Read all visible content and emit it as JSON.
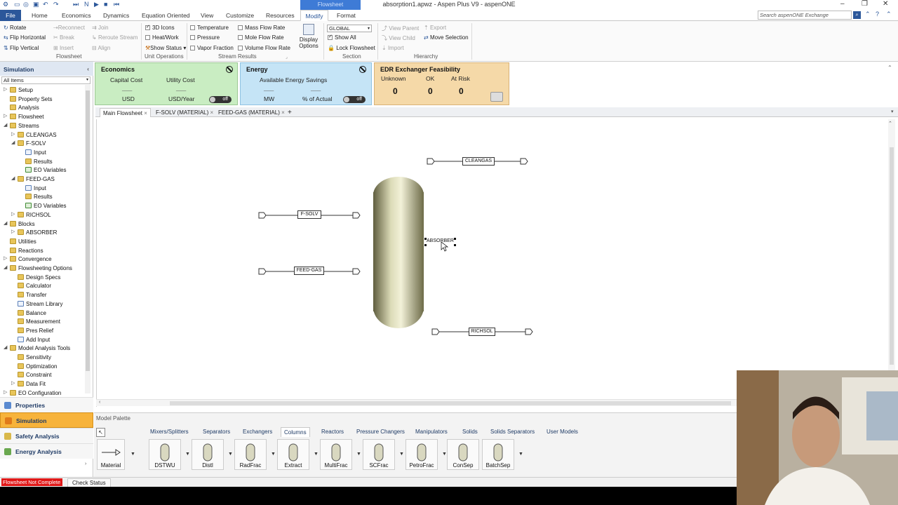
{
  "window": {
    "title": "absorption1.apwz - Aspen Plus V9 - aspenONE",
    "context_tab": "Flowsheet"
  },
  "menu": {
    "tabs": [
      "File",
      "Home",
      "Economics",
      "Dynamics",
      "Equation Oriented",
      "View",
      "Customize",
      "Resources",
      "Modify",
      "Format"
    ],
    "active": "Modify",
    "search_placeholder": "Search aspenONE Exchange"
  },
  "ribbon": {
    "flowsheet": {
      "rotate": "Rotate",
      "flip_horizontal": "Flip Horizontal",
      "flip_vertical": "Flip Vertical",
      "reconnect": "Reconnect",
      "break": "Break",
      "insert": "Insert",
      "join": "Join",
      "reroute": "Reroute Stream",
      "align": "Align",
      "group": "Flowsheet"
    },
    "unit_ops": {
      "icons3d": "3D Icons",
      "heatwork": "Heat/Work",
      "show_status": "Show Status",
      "group": "Unit Operations"
    },
    "stream_results": {
      "temperature": "Temperature",
      "pressure": "Pressure",
      "vapor_fraction": "Vapor Fraction",
      "mass_flow": "Mass Flow Rate",
      "mole_flow": "Mole Flow Rate",
      "volume_flow": "Volume Flow Rate",
      "group": "Stream Results"
    },
    "display_options": "Display Options",
    "section": {
      "select": "GLOBAL",
      "show_all": "Show All",
      "lock_flowsheet": "Lock Flowsheet",
      "group": "Section"
    },
    "hierarchy": {
      "view_parent": "View Parent",
      "view_child": "View Child",
      "import": "Import",
      "export": "Export",
      "move_selection": "Move Selection",
      "group": "Hierarchy"
    }
  },
  "nav": {
    "header": "Simulation",
    "filter": "All Items",
    "tree": [
      {
        "label": "Setup",
        "icon": "folder",
        "level": 1,
        "twisty": "▷"
      },
      {
        "label": "Property Sets",
        "icon": "folder",
        "level": 1,
        "twisty": ""
      },
      {
        "label": "Analysis",
        "icon": "folder",
        "level": 1,
        "twisty": ""
      },
      {
        "label": "Flowsheet",
        "icon": "folder",
        "level": 1,
        "twisty": "▷"
      },
      {
        "label": "Streams",
        "icon": "folder",
        "level": 1,
        "twisty": "◢"
      },
      {
        "label": "CLEANGAS",
        "icon": "folder",
        "level": 2,
        "twisty": "▷"
      },
      {
        "label": "F-SOLV",
        "icon": "folder",
        "level": 2,
        "twisty": "◢"
      },
      {
        "label": "Input",
        "icon": "form",
        "level": 3,
        "twisty": ""
      },
      {
        "label": "Results",
        "icon": "folder",
        "level": 3,
        "twisty": ""
      },
      {
        "label": "EO Variables",
        "icon": "green",
        "level": 3,
        "twisty": ""
      },
      {
        "label": "FEED-GAS",
        "icon": "folder",
        "level": 2,
        "twisty": "◢"
      },
      {
        "label": "Input",
        "icon": "form",
        "level": 3,
        "twisty": ""
      },
      {
        "label": "Results",
        "icon": "folder",
        "level": 3,
        "twisty": ""
      },
      {
        "label": "EO Variables",
        "icon": "green",
        "level": 3,
        "twisty": ""
      },
      {
        "label": "RICHSOL",
        "icon": "folder",
        "level": 2,
        "twisty": "▷"
      },
      {
        "label": "Blocks",
        "icon": "folder",
        "level": 1,
        "twisty": "◢"
      },
      {
        "label": "ABSORBER",
        "icon": "folder",
        "level": 2,
        "twisty": "▷"
      },
      {
        "label": "Utilities",
        "icon": "folder",
        "level": 1,
        "twisty": ""
      },
      {
        "label": "Reactions",
        "icon": "folder",
        "level": 1,
        "twisty": ""
      },
      {
        "label": "Convergence",
        "icon": "folder",
        "level": 1,
        "twisty": "▷"
      },
      {
        "label": "Flowsheeting Options",
        "icon": "folder",
        "level": 1,
        "twisty": "◢"
      },
      {
        "label": "Design Specs",
        "icon": "folder",
        "level": 2,
        "twisty": ""
      },
      {
        "label": "Calculator",
        "icon": "folder",
        "level": 2,
        "twisty": ""
      },
      {
        "label": "Transfer",
        "icon": "folder",
        "level": 2,
        "twisty": ""
      },
      {
        "label": "Stream Library",
        "icon": "form",
        "level": 2,
        "twisty": ""
      },
      {
        "label": "Balance",
        "icon": "folder",
        "level": 2,
        "twisty": ""
      },
      {
        "label": "Measurement",
        "icon": "folder",
        "level": 2,
        "twisty": ""
      },
      {
        "label": "Pres Relief",
        "icon": "folder",
        "level": 2,
        "twisty": ""
      },
      {
        "label": "Add Input",
        "icon": "form",
        "level": 2,
        "twisty": ""
      },
      {
        "label": "Model Analysis Tools",
        "icon": "folder",
        "level": 1,
        "twisty": "◢"
      },
      {
        "label": "Sensitivity",
        "icon": "folder",
        "level": 2,
        "twisty": ""
      },
      {
        "label": "Optimization",
        "icon": "folder",
        "level": 2,
        "twisty": ""
      },
      {
        "label": "Constraint",
        "icon": "folder",
        "level": 2,
        "twisty": ""
      },
      {
        "label": "Data Fit",
        "icon": "folder",
        "level": 2,
        "twisty": "▷"
      },
      {
        "label": "EO Configuration",
        "icon": "folder",
        "level": 1,
        "twisty": "▷"
      }
    ],
    "buttons": [
      "Properties",
      "Simulation",
      "Safety Analysis",
      "Energy Analysis"
    ],
    "active_button": "Simulation"
  },
  "dashboard": {
    "economics": {
      "title": "Economics",
      "capital_cost": "Capital Cost",
      "utility_cost": "Utility Cost",
      "dash1": "___",
      "dash2": "___",
      "unit1": "USD",
      "unit2": "USD/Year",
      "toggle": "off",
      "color": "#c9edc2"
    },
    "energy": {
      "title": "Energy",
      "available": "Available Energy Savings",
      "dash1": "___",
      "dash2": "___",
      "unit1": "MW",
      "unit2": "% of Actual",
      "toggle": "off",
      "color": "#c5e4f6"
    },
    "edr": {
      "title": "EDR Exchanger Feasibility",
      "unknown": "Unknown",
      "ok": "OK",
      "at_risk": "At Risk",
      "unknown_val": "0",
      "ok_val": "0",
      "at_risk_val": "0",
      "color": "#f5d9a8"
    }
  },
  "doc_tabs": [
    "Main Flowsheet",
    "F-SOLV (MATERIAL)",
    "FEED-GAS (MATERIAL)"
  ],
  "flowsheet": {
    "block": "ABSORBER",
    "streams": [
      "CLEANGAS",
      "F-SOLV",
      "FEED-GAS",
      "RICHSOL"
    ]
  },
  "palette": {
    "title": "Model Palette",
    "tabs": [
      "Mixers/Splitters",
      "Separators",
      "Exchangers",
      "Columns",
      "Reactors",
      "Pressure Changers",
      "Manipulators",
      "Solids",
      "Solids Separators",
      "User Models"
    ],
    "active_tab": "Columns",
    "items": [
      "Material",
      "DSTWU",
      "Distl",
      "RadFrac",
      "Extract",
      "MultiFrac",
      "SCFrac",
      "PetroFrac",
      "ConSep",
      "BatchSep"
    ]
  },
  "status": {
    "state": "Flowsheet Not Complete",
    "check": "Check Status"
  }
}
